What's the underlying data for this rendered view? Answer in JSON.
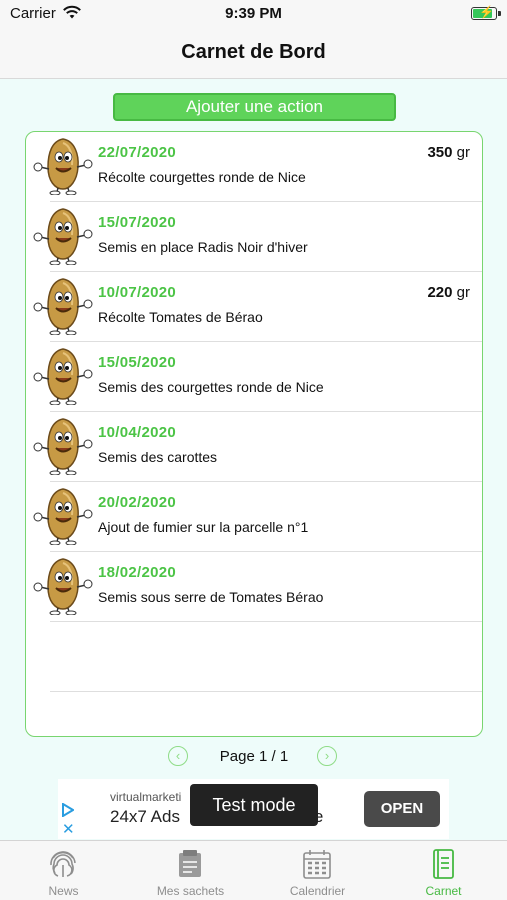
{
  "status_bar": {
    "carrier": "Carrier",
    "time": "9:39 PM"
  },
  "navbar": {
    "title": "Carnet de Bord"
  },
  "add_button": {
    "label": "Ajouter une action"
  },
  "entries": [
    {
      "date": "22/07/2020",
      "description": "Récolte courgettes ronde de Nice",
      "quantity": "350",
      "unit": "gr"
    },
    {
      "date": "15/07/2020",
      "description": "Semis en place Radis Noir d'hiver",
      "quantity": "",
      "unit": ""
    },
    {
      "date": "10/07/2020",
      "description": "Récolte Tomates de Bérao",
      "quantity": "220",
      "unit": "gr"
    },
    {
      "date": "15/05/2020",
      "description": "Semis des courgettes ronde de Nice",
      "quantity": "",
      "unit": ""
    },
    {
      "date": "10/04/2020",
      "description": "Semis des carottes",
      "quantity": "",
      "unit": ""
    },
    {
      "date": "20/02/2020",
      "description": "Ajout de fumier sur la parcelle n°1",
      "quantity": "",
      "unit": ""
    },
    {
      "date": "18/02/2020",
      "description": "Semis sous serre de Tomates Bérao",
      "quantity": "",
      "unit": ""
    }
  ],
  "pager": {
    "label": "Page 1 / 1",
    "prev_icon": "chevron-left-circle-icon",
    "next_icon": "chevron-right-circle-icon"
  },
  "ad": {
    "domain": "virtualmarketi",
    "headline": "24x7 Ads",
    "headline_tail": "alable",
    "open_label": "OPEN",
    "toast": "Test mode"
  },
  "tabs": [
    {
      "label": "News",
      "icon": "fingerprint-icon",
      "active": false
    },
    {
      "label": "Mes sachets",
      "icon": "seed-packet-icon",
      "active": false
    },
    {
      "label": "Calendrier",
      "icon": "calendar-icon",
      "active": false
    },
    {
      "label": "Carnet",
      "icon": "notebook-icon",
      "active": true
    }
  ],
  "colors": {
    "accent_green": "#4cc446",
    "button_green": "#5fd35a",
    "background": "#eefcfa"
  }
}
